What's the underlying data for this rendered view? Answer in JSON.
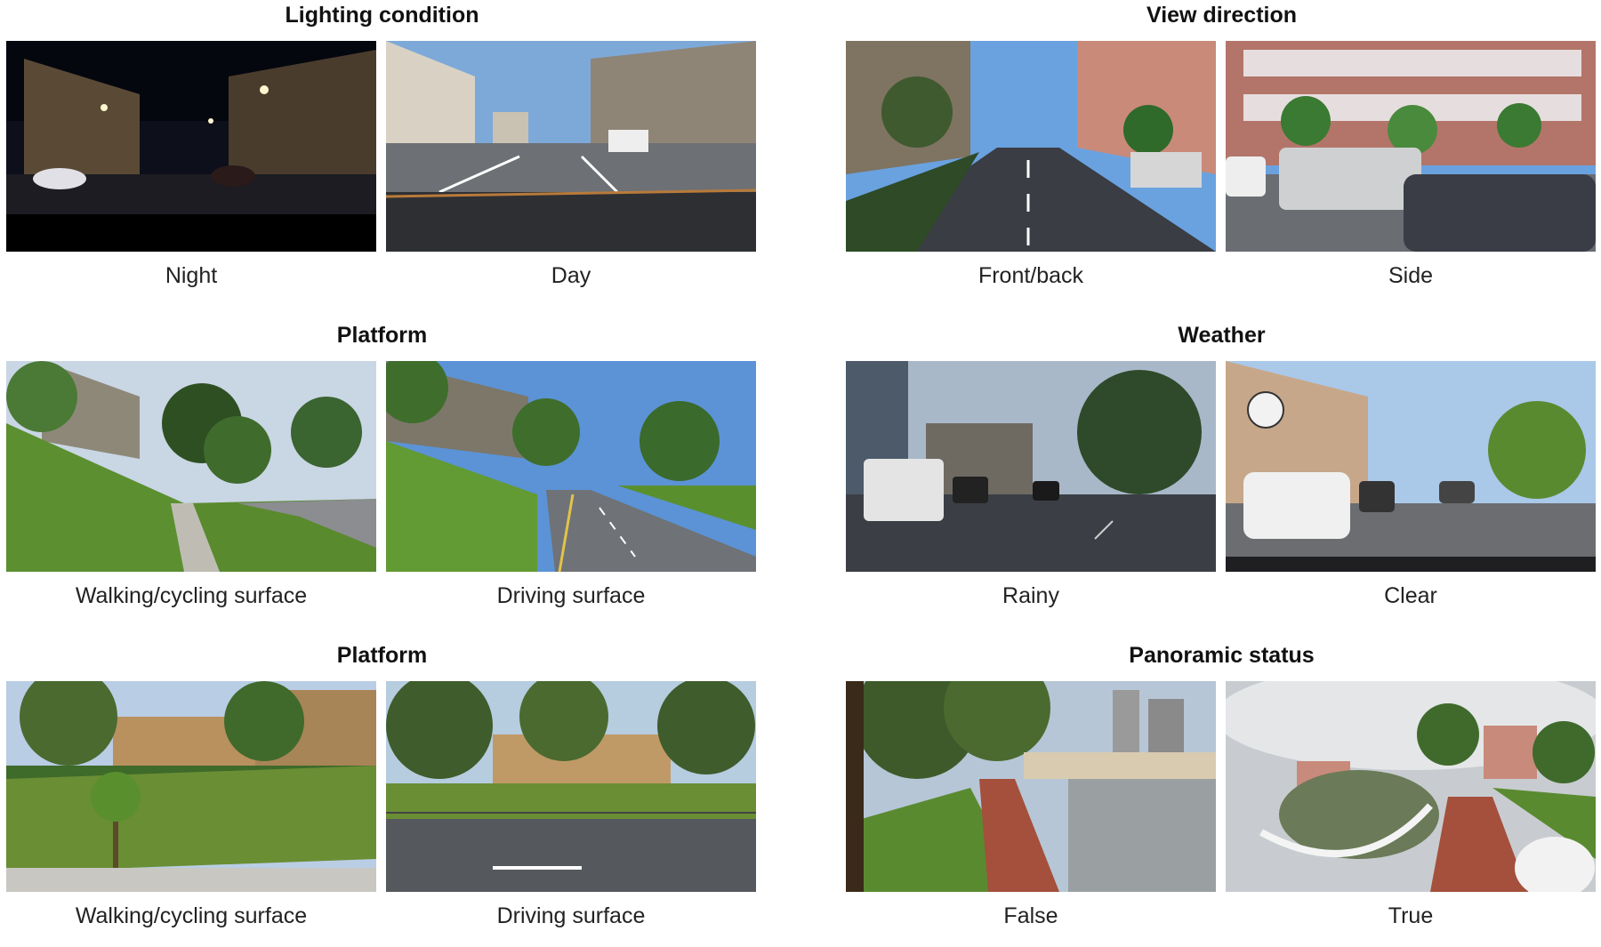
{
  "sections": [
    {
      "title": "Lighting condition",
      "left_caption": "Night",
      "right_caption": "Day"
    },
    {
      "title": "View direction",
      "left_caption": "Front/back",
      "right_caption": "Side"
    },
    {
      "title": "Platform",
      "left_caption": "Walking/cycling surface",
      "right_caption": "Driving surface"
    },
    {
      "title": "Weather",
      "left_caption": "Rainy",
      "right_caption": "Clear"
    },
    {
      "title": "Platform",
      "left_caption": "Walking/cycling surface",
      "right_caption": "Driving surface"
    },
    {
      "title": "Panoramic status",
      "left_caption": "False",
      "right_caption": "True"
    }
  ]
}
